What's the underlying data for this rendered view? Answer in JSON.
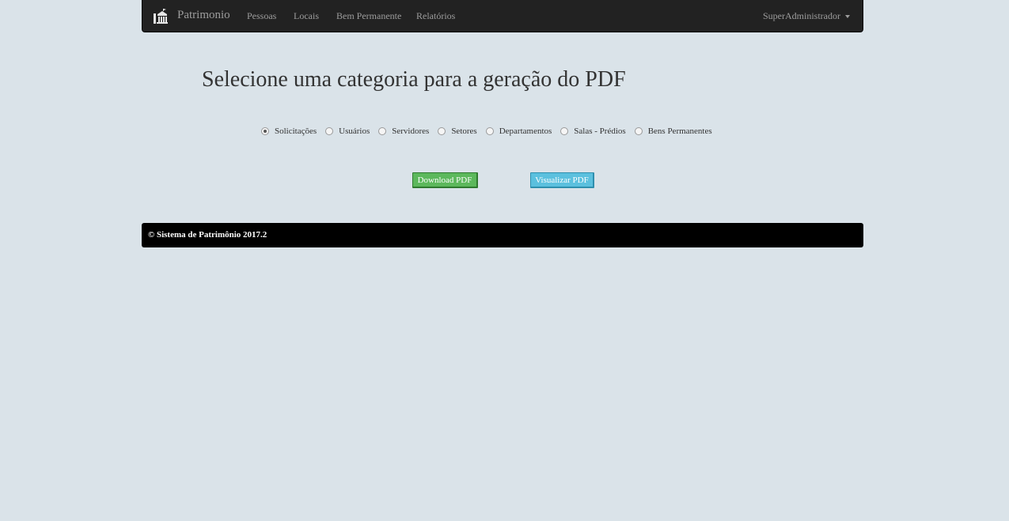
{
  "navbar": {
    "logo_icon": "uag-building-logo-icon",
    "brand": "Patrimonio",
    "links": [
      "Pessoas",
      "Locais",
      "Bem Permanente",
      "Relatórios"
    ],
    "user_menu": "SuperAdministrador",
    "background": "#222222",
    "link_color": "#9d9d9d"
  },
  "main": {
    "title": "Selecione uma categoria para a geração do PDF",
    "categories": [
      {
        "label": "Solicitações",
        "checked": true
      },
      {
        "label": "Usuários",
        "checked": false
      },
      {
        "label": "Servidores",
        "checked": false
      },
      {
        "label": "Setores",
        "checked": false
      },
      {
        "label": "Departamentos",
        "checked": false
      },
      {
        "label": "Salas - Prédios",
        "checked": false
      },
      {
        "label": "Bens Permanentes",
        "checked": false
      }
    ],
    "buttons": {
      "download": "Download PDF",
      "view": "Visualizar PDF",
      "download_color": "#5cb85c",
      "view_color": "#5bc0de"
    }
  },
  "footer": {
    "text": "© Sistema de Patrimônio 2017.2",
    "background": "#000000"
  },
  "page_background": "#dae3e9"
}
